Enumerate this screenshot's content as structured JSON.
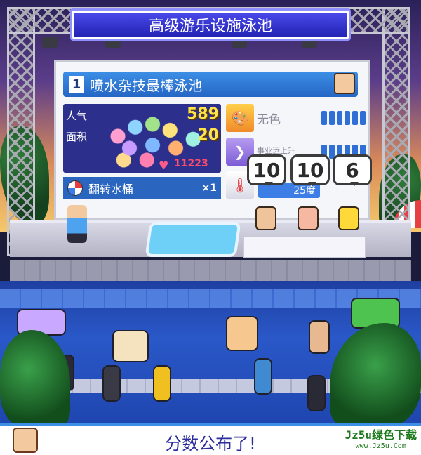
{
  "header": {
    "title": "高级游乐设施泳池"
  },
  "ranking": {
    "rank": "1",
    "name": "喷水杂技最棒泳池"
  },
  "stats": {
    "popularity_label": "人气",
    "popularity_value": "589",
    "area_label": "面积",
    "area_value": "20",
    "hearts_value": "11223"
  },
  "item": {
    "name": "翻转水桶",
    "count": "×1"
  },
  "attributes": {
    "color_label": "无色",
    "business_label": "事业运上升",
    "temperature_label": "25度"
  },
  "scores": [
    "10",
    "10",
    "6"
  ],
  "message": {
    "text": "分数公布了!"
  },
  "watermark": {
    "main": "Jz5u绿色下载",
    "sub": "www.Jz5u.Com"
  },
  "colors": {
    "banner": "#2f2fd0",
    "rank_bar": "#3d8fe6",
    "score_yellow": "#ffe34a",
    "pool": "#2a58c8"
  }
}
